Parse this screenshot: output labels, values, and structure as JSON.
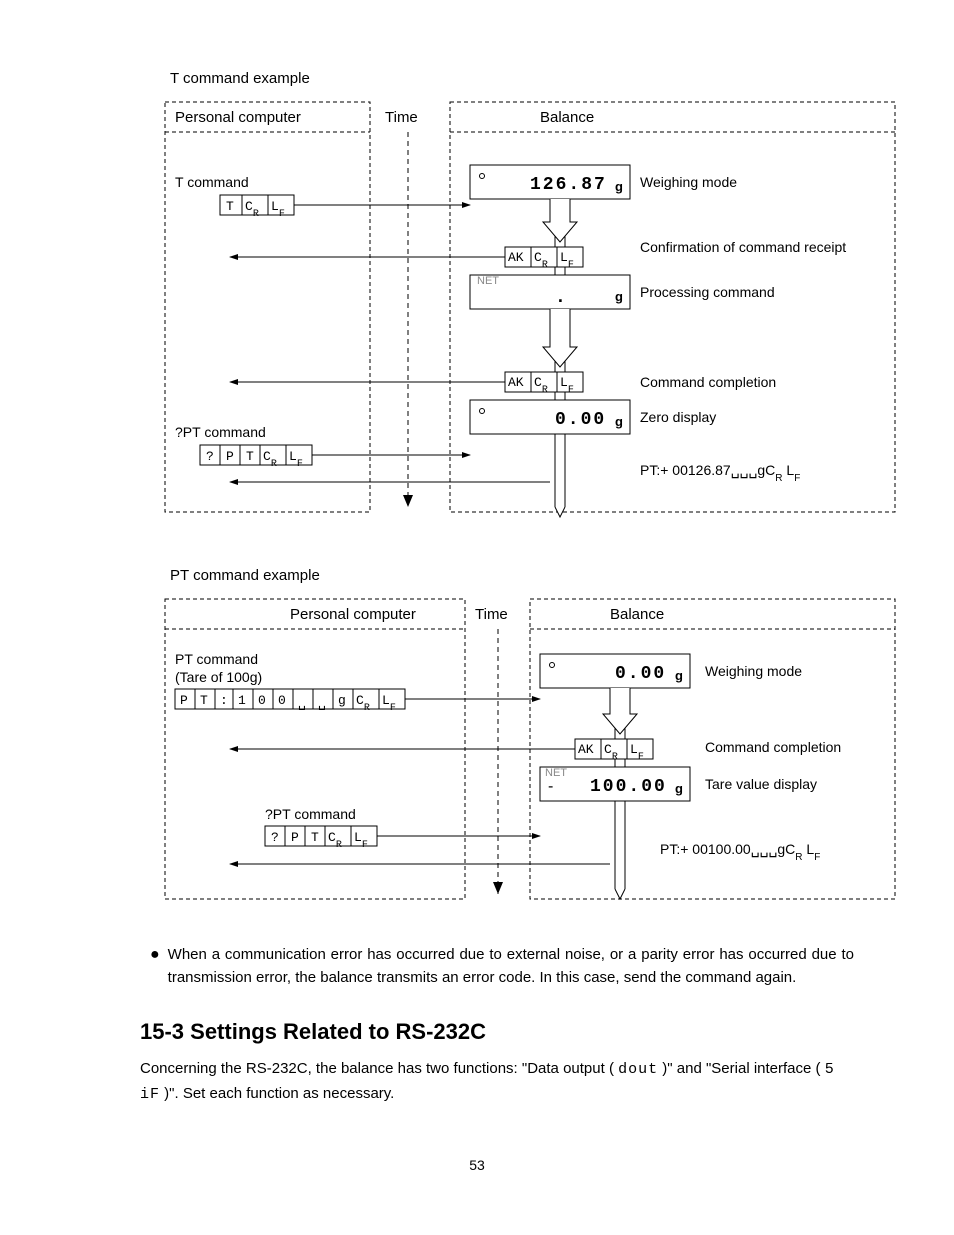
{
  "ex1": {
    "caption": "T command example",
    "pc_header": "Personal computer",
    "time_header": "Time",
    "balance_header": "Balance",
    "t_cmd_label": "T command",
    "t_cmd_cells": [
      "T",
      "C_R",
      "L_F"
    ],
    "pt_cmd_label": "?PT command",
    "pt_cmd_cells": [
      "?",
      "P",
      "T",
      "C_R",
      "L_F"
    ],
    "ak_cells": [
      "AK",
      "C_R",
      "L_F"
    ],
    "disp1_val": "126.87",
    "disp1_unit": "g",
    "desc1": "Weighing mode",
    "desc2": "Confirmation of command receipt",
    "disp2_net": "NET",
    "disp2_unit": "g",
    "desc3": "Processing command",
    "desc4": "Command completion",
    "disp3_val": "0.00",
    "disp3_unit": "g",
    "desc5": "Zero display",
    "reply": "PT:+ 00126.87␣␣␣gC_R L_F"
  },
  "ex2": {
    "caption": "PT command example",
    "pc_header": "Personal computer",
    "time_header": "Time",
    "balance_header": "Balance",
    "pt_cmd_label": "PT command",
    "pt_cmd_note": "(Tare of 100g)",
    "pt_cmd_cells": [
      "P",
      "T",
      ":",
      "1",
      "0",
      "0",
      "␣",
      "␣",
      "g",
      "C_R",
      "L_F"
    ],
    "qpt_cmd_label": "?PT command",
    "qpt_cmd_cells": [
      "?",
      "P",
      "T",
      "C_R",
      "L_F"
    ],
    "ak_cells": [
      "AK",
      "C_R",
      "L_F"
    ],
    "disp1_val": "0.00",
    "disp1_unit": "g",
    "desc1": "Weighing mode",
    "desc2": "Command completion",
    "disp2_net": "NET",
    "disp2_val": "100.00",
    "disp2_unit": "g",
    "desc3": "Tare value display",
    "reply": "PT:+ 00100.00␣␣␣gC_R L_F"
  },
  "bullet": "When a communication error has occurred due to external noise, or a parity error has occurred due to transmission error, the balance transmits an error code. In this case, send the command again.",
  "section_title": "15-3  Settings Related to RS-232C",
  "section_body_a": "Concerning the RS-232C, the balance has two functions: \"Data output ( ",
  "section_body_code1": "dout",
  "section_body_b": " )\" and \"Serial interface ( ",
  "section_body_code2": "5 iF",
  "section_body_c": " )\". Set each function as necessary.",
  "page_num": "53"
}
